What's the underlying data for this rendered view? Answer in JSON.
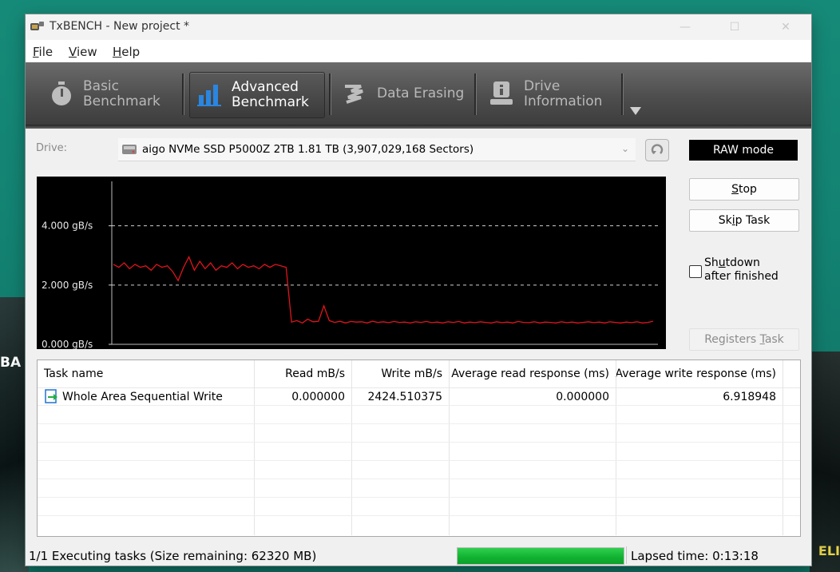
{
  "window": {
    "title": "TxBENCH - New project *"
  },
  "menu": {
    "items": [
      {
        "key": "F",
        "rest": "ile"
      },
      {
        "key": "V",
        "rest": "iew"
      },
      {
        "key": "H",
        "rest": "elp"
      }
    ]
  },
  "ribbon": {
    "tabs": [
      {
        "line1": "Basic",
        "line2": "Benchmark"
      },
      {
        "line1": "Advanced",
        "line2": "Benchmark"
      },
      {
        "line1": "Data Erasing",
        "line2": ""
      },
      {
        "line1": "Drive",
        "line2": "Information"
      }
    ],
    "active_index": 1
  },
  "drive": {
    "label": "Drive:",
    "value": "aigo NVMe SSD P5000Z 2TB  1.81 TB (3,907,029,168 Sectors)"
  },
  "raw_mode": "RAW mode",
  "buttons": {
    "stop": {
      "pre": "",
      "key": "S",
      "post": "top"
    },
    "skip": {
      "pre": "Sk",
      "key": "i",
      "post": "p Task"
    },
    "registers": {
      "pre": "Registers ",
      "key": "T",
      "post": "ask"
    }
  },
  "shutdown": {
    "line1_pre": "Sh",
    "line1_key": "u",
    "line1_post": "tdown",
    "line2": "after finished",
    "checked": false
  },
  "chart_data": {
    "type": "line",
    "y_tick_labels": [
      "4.000 gB/s",
      "2.000 gB/s",
      "0.000 gB/s"
    ],
    "y_ticks": [
      4.0,
      2.0,
      0.0
    ],
    "ylim": [
      0,
      5.5
    ],
    "grid": "dashed horizontal at ticks",
    "series": [
      {
        "color": "#e0141c",
        "x": [
          0,
          1,
          2,
          3,
          4,
          5,
          6,
          7,
          8,
          9,
          10,
          11,
          12,
          13,
          14,
          15,
          16,
          17,
          18,
          19,
          20,
          21,
          22,
          23,
          24,
          25,
          26,
          27,
          28,
          29,
          30,
          31,
          32,
          33,
          34,
          35,
          36,
          37,
          38,
          39,
          40,
          41,
          42,
          43,
          44,
          45,
          46,
          47,
          48,
          49,
          50,
          51,
          52,
          53,
          54,
          55,
          56,
          57,
          58,
          59,
          60,
          61,
          62,
          63,
          64,
          65,
          66,
          67,
          68,
          69,
          70,
          71,
          72,
          73,
          74,
          75,
          76,
          77,
          78,
          79,
          80,
          81,
          82,
          83,
          84,
          85,
          86,
          87,
          88,
          89,
          90,
          91,
          92,
          93,
          94,
          95,
          96,
          97,
          98,
          99,
          100
        ],
        "values": [
          2.7,
          2.6,
          2.75,
          2.55,
          2.7,
          2.6,
          2.65,
          2.5,
          2.7,
          2.6,
          2.65,
          2.45,
          2.15,
          2.6,
          2.95,
          2.5,
          2.8,
          2.55,
          2.75,
          2.5,
          2.65,
          2.6,
          2.75,
          2.55,
          2.7,
          2.6,
          2.65,
          2.55,
          2.7,
          2.6,
          2.7,
          2.65,
          2.6,
          0.75,
          0.8,
          0.72,
          0.85,
          0.76,
          0.78,
          1.3,
          0.8,
          0.74,
          0.78,
          0.72,
          0.77,
          0.75,
          0.76,
          0.72,
          0.78,
          0.74,
          0.76,
          0.73,
          0.77,
          0.74,
          0.75,
          0.72,
          0.76,
          0.74,
          0.77,
          0.73,
          0.75,
          0.72,
          0.76,
          0.74,
          0.77,
          0.72,
          0.75,
          0.73,
          0.76,
          0.74,
          0.72,
          0.76,
          0.73,
          0.75,
          0.72,
          0.77,
          0.74,
          0.73,
          0.76,
          0.72,
          0.75,
          0.74,
          0.72,
          0.76,
          0.73,
          0.75,
          0.72,
          0.74,
          0.76,
          0.73,
          0.75,
          0.72,
          0.76,
          0.74,
          0.72,
          0.75,
          0.73,
          0.76,
          0.72,
          0.74,
          0.78
        ]
      }
    ]
  },
  "table": {
    "columns": [
      "Task name",
      "Read mB/s",
      "Write mB/s",
      "Average read response (ms)",
      "Average write response (ms)"
    ],
    "rows": [
      {
        "name": "Whole Area Sequential Write",
        "read": "0.000000",
        "write": "2424.510375",
        "avg_read": "0.000000",
        "avg_write": "6.918948"
      }
    ]
  },
  "status": {
    "tasks": "1/1 Executing tasks (Size remaining: 62320 MB)",
    "progress_fraction": 1.0,
    "lapsed": "Lapsed time: 0:13:18"
  },
  "colors": {
    "ribbon_bg": "#4e4e4e",
    "progress": "#10b030",
    "chart_line": "#e0141c",
    "accent_icon": "#1e74d0"
  }
}
